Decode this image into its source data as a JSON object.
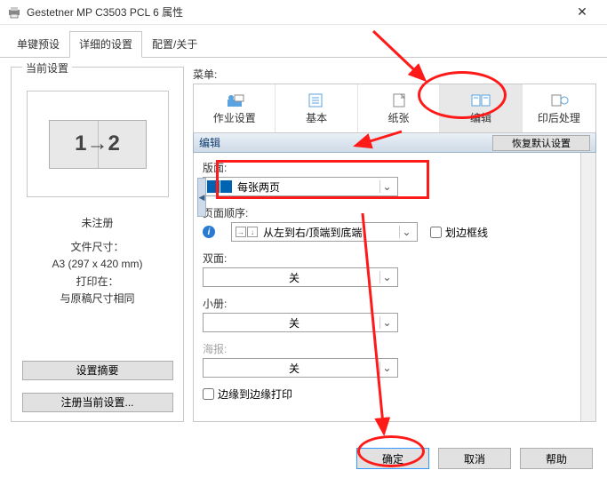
{
  "window": {
    "title": "Gestetner MP C3503 PCL 6 属性"
  },
  "tabs": {
    "t0": "单键预设",
    "t1": "详细的设置",
    "t2": "配置/关于"
  },
  "left": {
    "group": "当前设置",
    "preview": "1→2",
    "unregistered": "未注册",
    "filesize_label": "文件尺寸：",
    "filesize_value": "A3 (297 x 420 mm)",
    "printon_label": "打印在：",
    "printon_value": "与原稿尺寸相同",
    "summary_btn": "设置摘要",
    "register_btn": "注册当前设置..."
  },
  "menu_label": "菜单:",
  "toolbar": {
    "job": "作业设置",
    "basic": "基本",
    "paper": "纸张",
    "edit": "编辑",
    "finish": "印后处理"
  },
  "section": {
    "title": "编辑",
    "restore": "恢复默认设置"
  },
  "fields": {
    "layout_label": "版面:",
    "layout_value": "每张两页",
    "order_label": "页面顺序:",
    "order_value": "从左到右/顶端到底端",
    "border_chk": "划边框线",
    "duplex_label": "双面:",
    "duplex_value": "关",
    "booklet_label": "小册:",
    "booklet_value": "关",
    "poster_label": "海报:",
    "poster_value": "关",
    "edge_chk": "边缘到边缘打印"
  },
  "footer": {
    "ok": "确定",
    "cancel": "取消",
    "help": "帮助"
  }
}
